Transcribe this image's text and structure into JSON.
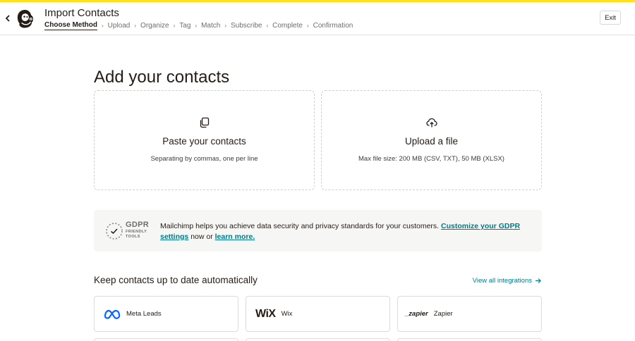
{
  "header": {
    "title": "Import Contacts",
    "exit_label": "Exit",
    "steps": [
      "Choose Method",
      "Upload",
      "Organize",
      "Tag",
      "Match",
      "Subscribe",
      "Complete",
      "Confirmation"
    ],
    "active_step": "Choose Method"
  },
  "main": {
    "title": "Add your contacts",
    "methods": [
      {
        "title": "Paste your contacts",
        "desc": "Separating by commas, one per line",
        "icon": "copy-icon"
      },
      {
        "title": "Upload a file",
        "desc": "Max file size: 200 MB (CSV, TXT), 50 MB (XLSX)",
        "icon": "cloud-upload-icon"
      }
    ]
  },
  "gdpr": {
    "badge_title": "GDPR",
    "badge_line1": "FRIENDLY",
    "badge_line2": "TOOLS",
    "text_main": "Mailchimp helps you achieve data security and privacy standards for your customers.",
    "link_customize": "Customize your GDPR settings",
    "text_middle": "now or",
    "link_learn": "learn more."
  },
  "integrations": {
    "title": "Keep contacts up to date automatically",
    "view_all": "View all integrations",
    "items": [
      {
        "name": "Meta Leads",
        "icon": "meta-icon"
      },
      {
        "name": "Wix",
        "logo_text": "WiX",
        "icon": "wix-logo"
      },
      {
        "name": "Zapier",
        "logo_text": "_zapier",
        "icon": "zapier-logo"
      }
    ]
  },
  "colors": {
    "accent_yellow": "#ffe01b",
    "link_teal": "#007c89",
    "text_dark": "#241c15"
  }
}
